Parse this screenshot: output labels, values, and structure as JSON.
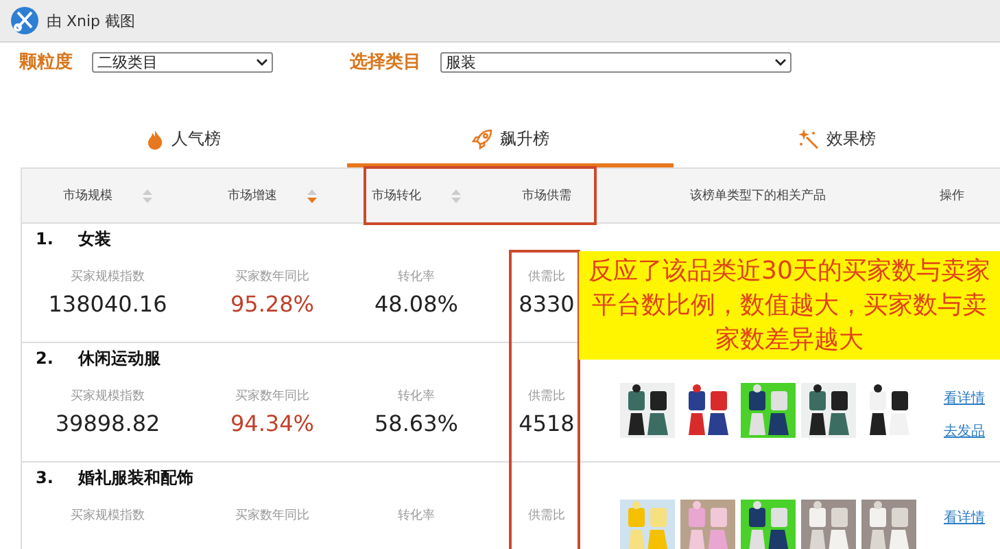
{
  "window": {
    "title": "由 Xnip 截图"
  },
  "filters": [
    {
      "label": "颗粒度",
      "value": "二级类目"
    },
    {
      "label": "选择类目",
      "value": "服装"
    }
  ],
  "tabs": [
    {
      "label": "人气榜",
      "selected": false
    },
    {
      "label": "飙升榜",
      "selected": true
    },
    {
      "label": "效果榜",
      "selected": false
    }
  ],
  "columns": [
    {
      "label": "市场规模",
      "sorted": false
    },
    {
      "label": "市场增速",
      "sorted": true
    },
    {
      "label": "市场转化",
      "sorted": false
    },
    {
      "label": "市场供需"
    },
    {
      "label": "该榜单类型下的相关产品"
    },
    {
      "label": "操作"
    }
  ],
  "rows": [
    {
      "rank": "1.",
      "name": "女装",
      "metrics": [
        {
          "label": "买家规模指数",
          "value": "138040.16",
          "highlight": false
        },
        {
          "label": "买家数年同比",
          "value": "95.28%",
          "highlight": true
        },
        {
          "label": "转化率",
          "value": "48.08%",
          "highlight": false
        },
        {
          "label": "供需比",
          "value": "8330",
          "highlight": false
        }
      ],
      "products": [],
      "actions": []
    },
    {
      "rank": "2.",
      "name": "休闲运动服",
      "metrics": [
        {
          "label": "买家规模指数",
          "value": "39898.82",
          "highlight": false
        },
        {
          "label": "买家数年同比",
          "value": "94.34%",
          "highlight": true
        },
        {
          "label": "转化率",
          "value": "58.63%",
          "highlight": false
        },
        {
          "label": "供需比",
          "value": "4518",
          "highlight": false
        }
      ],
      "products": [
        {
          "kind": "picture"
        },
        {
          "kind": "picture"
        },
        {
          "kind": "picture"
        },
        {
          "kind": "picture"
        },
        {
          "kind": "picture"
        }
      ],
      "actions": [
        "看详情",
        "去发品"
      ]
    },
    {
      "rank": "3.",
      "name": "婚礼服装和配饰",
      "metrics": [
        {
          "label": "买家规模指数"
        },
        {
          "label": "买家数年同比"
        },
        {
          "label": "转化率"
        },
        {
          "label": "供需比"
        }
      ],
      "products": [
        {
          "kind": "picture"
        },
        {
          "kind": "picture"
        },
        {
          "kind": "picture"
        },
        {
          "kind": "picture"
        },
        {
          "kind": "picture"
        }
      ],
      "actions": [
        "看详情"
      ]
    }
  ],
  "callout": "反应了该品类近30天的买家数与卖家平台数比例，数值越大，买家数与卖家数差异越大"
}
